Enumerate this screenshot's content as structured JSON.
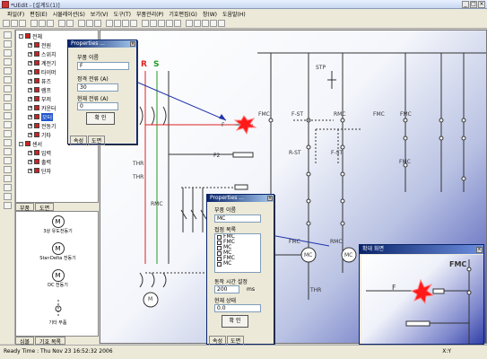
{
  "window": {
    "title": "*UEdit - [설계도(1)]"
  },
  "menu": [
    "파일(F)",
    "편집(E)",
    "시뮬레이션(S)",
    "보기(V)",
    "도구(T)",
    "부품관리(P)",
    "기호편집(G)",
    "창(W)",
    "도움말(H)"
  ],
  "tree": {
    "items": [
      {
        "label": "전체",
        "level": 0
      },
      {
        "label": "전원",
        "level": 1
      },
      {
        "label": "스위치",
        "level": 1
      },
      {
        "label": "계전기",
        "level": 1
      },
      {
        "label": "타이머",
        "level": 1
      },
      {
        "label": "퓨즈",
        "level": 1
      },
      {
        "label": "램프",
        "level": 1
      },
      {
        "label": "부저",
        "level": 1
      },
      {
        "label": "카운터",
        "level": 1
      },
      {
        "label": "모터",
        "level": 1,
        "selected": true
      },
      {
        "label": "전동기",
        "level": 1
      },
      {
        "label": "기타",
        "level": 1
      },
      {
        "label": "센서",
        "level": 0
      },
      {
        "label": "입력",
        "level": 1
      },
      {
        "label": "출력",
        "level": 1
      },
      {
        "label": "단자",
        "level": 1
      }
    ]
  },
  "tabs_top": [
    "부품",
    "도면"
  ],
  "symbols": [
    {
      "label": "M",
      "caption": "3상 유도전동기"
    },
    {
      "label": "M",
      "caption": "Star-Delta 전동기"
    },
    {
      "label": "M",
      "caption": "DC 전동기"
    },
    {
      "label": "",
      "caption": "기타 부품"
    }
  ],
  "tabs_bot": [
    "심볼",
    "기호 목록"
  ],
  "status": {
    "text": "Ready  Time : Thu Nov 23 16:52:32 2006",
    "size": "X:Y"
  },
  "canvas": {
    "phase_r": "R",
    "phase_s": "S",
    "labels": [
      "STP",
      "FMC",
      "F-ST",
      "RMC",
      "FMC",
      "FMC",
      "R-ST",
      "F-ST",
      "FMC",
      "F",
      "THR",
      "F2",
      "THR",
      "RMC",
      "FMC",
      "RMC",
      "MC",
      "MC",
      "THR",
      "M"
    ]
  },
  "dialog1": {
    "title": "Properties ...",
    "label_name": "부품 이름",
    "value_name": "F",
    "label_rated": "정격 전류 (A)",
    "value_rated": "30",
    "label_current": "현재 전류 (A)",
    "value_current": "0",
    "button": "확 인",
    "tab1": "속성",
    "tab2": "도면"
  },
  "dialog2": {
    "title": "Properties ...",
    "label_name": "부품 이름",
    "value_name": "MC",
    "label_contacts": "접점 목록",
    "contacts": [
      "FMC",
      "FMC",
      "MC",
      "MC",
      "FMC",
      "MC"
    ],
    "label_time": "동작 시간 설정",
    "value_time": "200",
    "unit_time": "ms",
    "label_state": "현재 상태",
    "value_state": "0.0",
    "button": "확 인",
    "tab1": "속성",
    "tab2": "도면"
  },
  "preview": {
    "title": "확대 화면",
    "label_fmc": "FMC",
    "label_f": "F"
  }
}
